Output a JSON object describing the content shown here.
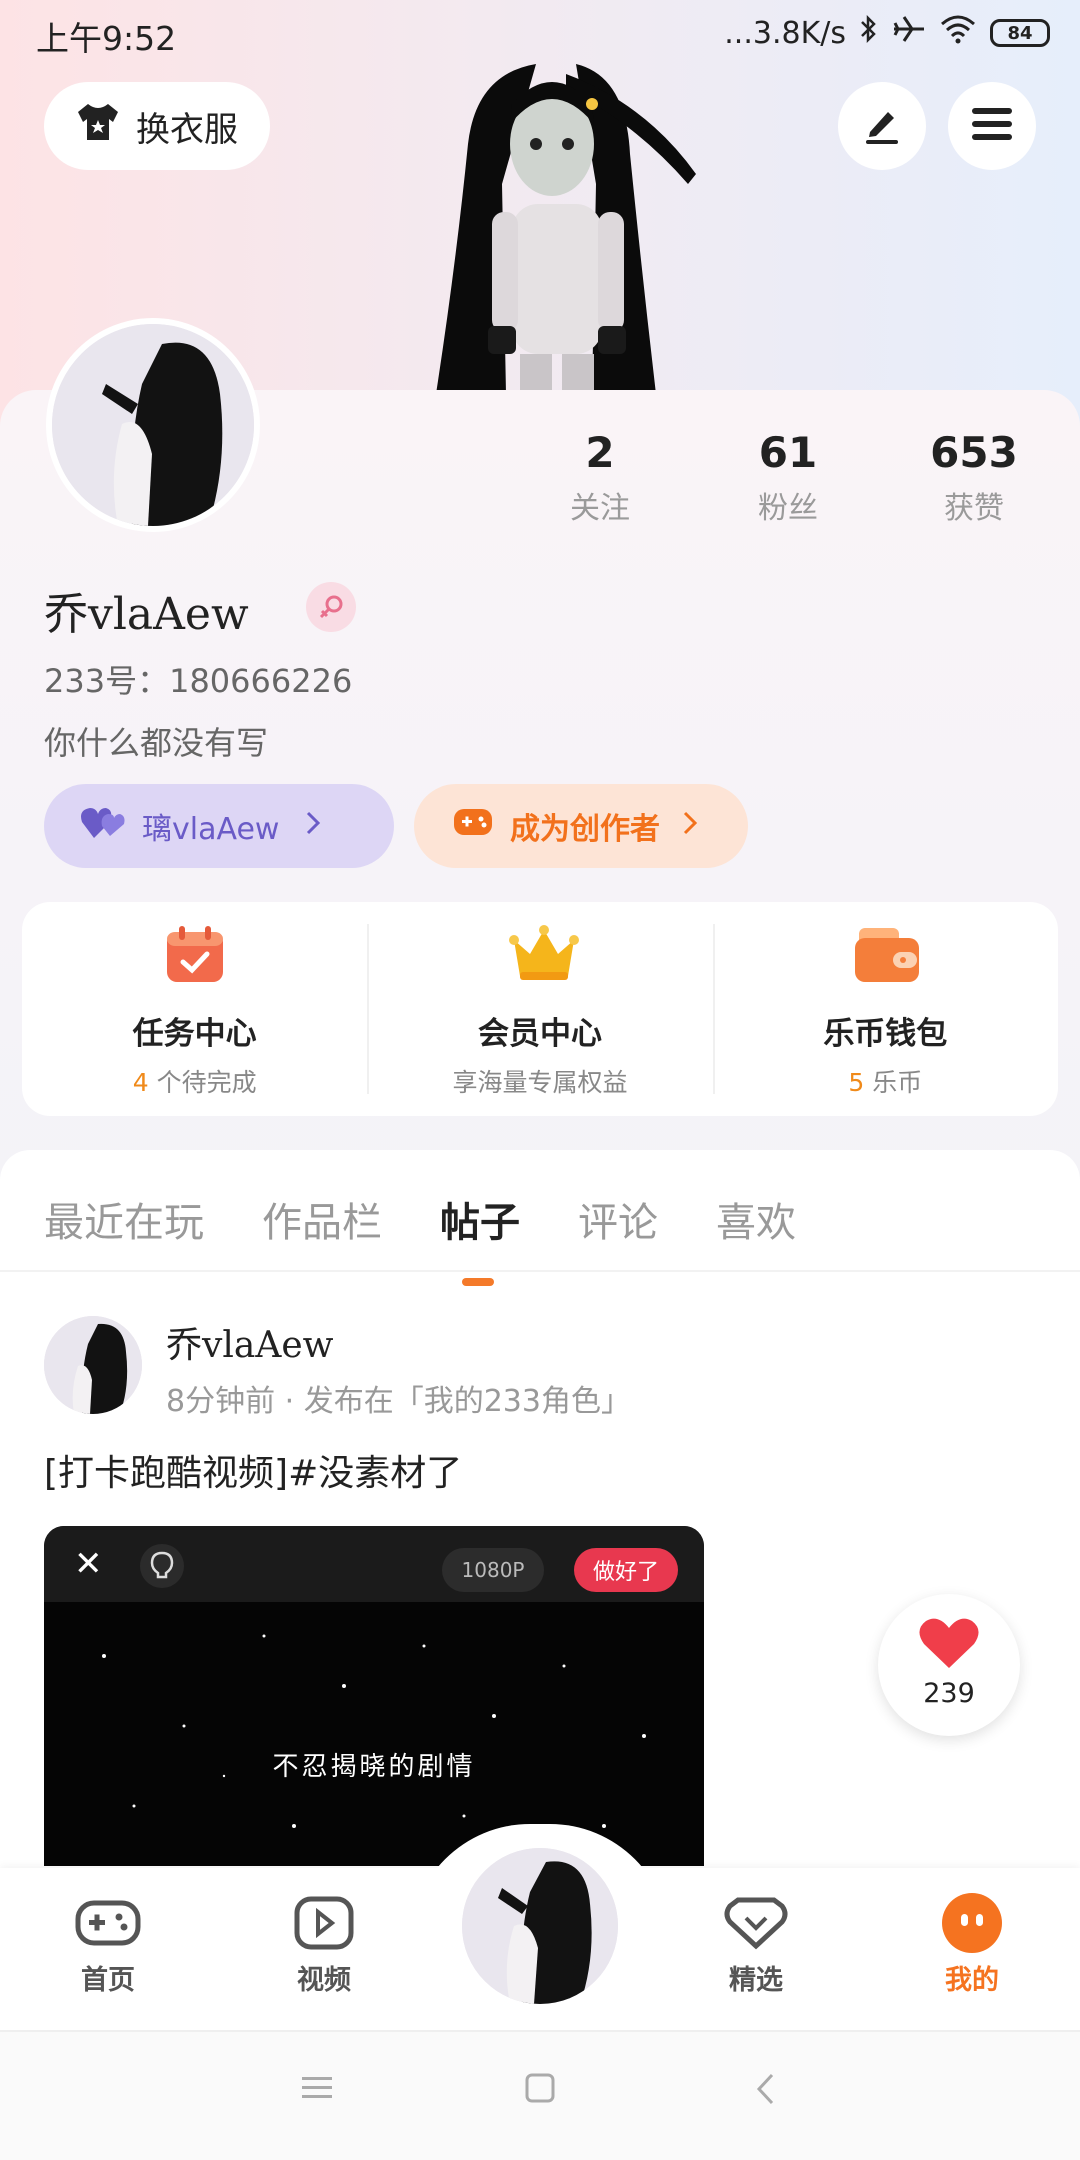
{
  "status_bar": {
    "time": "上午9:52",
    "network": "...3.8K/s",
    "battery": "84"
  },
  "header": {
    "outfit_button": "换衣服",
    "edit_icon": "edit-icon",
    "menu_icon": "menu-icon"
  },
  "profile": {
    "username": "乔vlaAew",
    "id_line": "233号：180666226",
    "bio": "你什么都没有写",
    "stats": [
      {
        "value": "2",
        "label": "关注"
      },
      {
        "value": "61",
        "label": "粉丝"
      },
      {
        "value": "653",
        "label": "获赞"
      }
    ],
    "tag_purple": "璃vlaAew",
    "tag_orange": "成为创作者"
  },
  "features": [
    {
      "title": "任务中心",
      "highlight": "4",
      "sub": " 个待完成"
    },
    {
      "title": "会员中心",
      "highlight": "",
      "sub": "享海量专属权益"
    },
    {
      "title": "乐币钱包",
      "highlight": "5",
      "sub": " 乐币"
    }
  ],
  "tabs": [
    "最近在玩",
    "作品栏",
    "帖子",
    "评论",
    "喜欢"
  ],
  "active_tab": "帖子",
  "post": {
    "author": "乔vlaAew",
    "meta": "8分钟前 · 发布在「我的233角色」",
    "text": "[打卡跑酷视频]#没素材了",
    "video_resolution": "1080P",
    "video_done_label": "做好了",
    "video_caption": "不忍揭晓的剧情"
  },
  "like_float": {
    "count": "239"
  },
  "bottom_nav": [
    {
      "label": "首页"
    },
    {
      "label": "视频"
    },
    {
      "label": "精选"
    },
    {
      "label": "我的"
    }
  ],
  "colors": {
    "accent": "#f57320",
    "purple": "#6a5bc7",
    "like": "#f03e4a"
  }
}
